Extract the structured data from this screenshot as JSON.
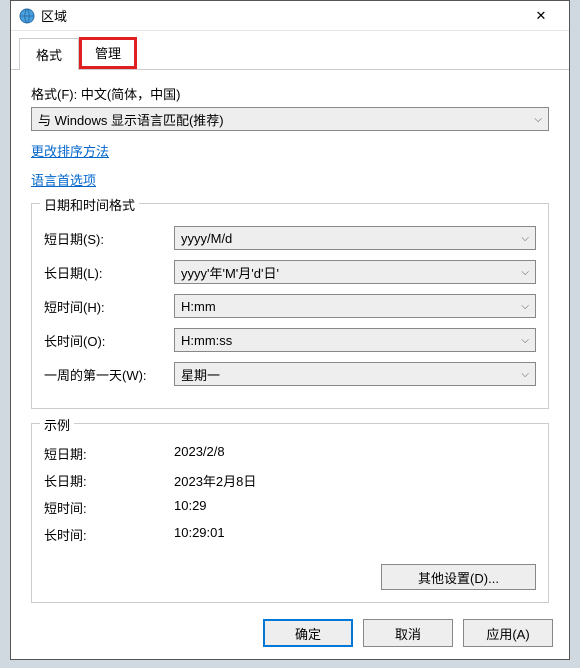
{
  "window": {
    "title": "区域"
  },
  "tabs": {
    "format": "格式",
    "admin": "管理"
  },
  "format": {
    "label": "格式(F): 中文(简体，中国)",
    "selected": "与 Windows 显示语言匹配(推荐)"
  },
  "links": {
    "sort": "更改排序方法",
    "lang": "语言首选项"
  },
  "datetime": {
    "title": "日期和时间格式",
    "short_date_label": "短日期(S):",
    "short_date_value": "yyyy/M/d",
    "long_date_label": "长日期(L):",
    "long_date_value": "yyyy'年'M'月'd'日'",
    "short_time_label": "短时间(H):",
    "short_time_value": "H:mm",
    "long_time_label": "长时间(O):",
    "long_time_value": "H:mm:ss",
    "first_day_label": "一周的第一天(W):",
    "first_day_value": "星期一"
  },
  "example": {
    "title": "示例",
    "short_date_label": "短日期:",
    "short_date_value": "2023/2/8",
    "long_date_label": "长日期:",
    "long_date_value": "2023年2月8日",
    "short_time_label": "短时间:",
    "short_time_value": "10:29",
    "long_time_label": "长时间:",
    "long_time_value": "10:29:01"
  },
  "buttons": {
    "other": "其他设置(D)...",
    "ok": "确定",
    "cancel": "取消",
    "apply": "应用(A)"
  }
}
